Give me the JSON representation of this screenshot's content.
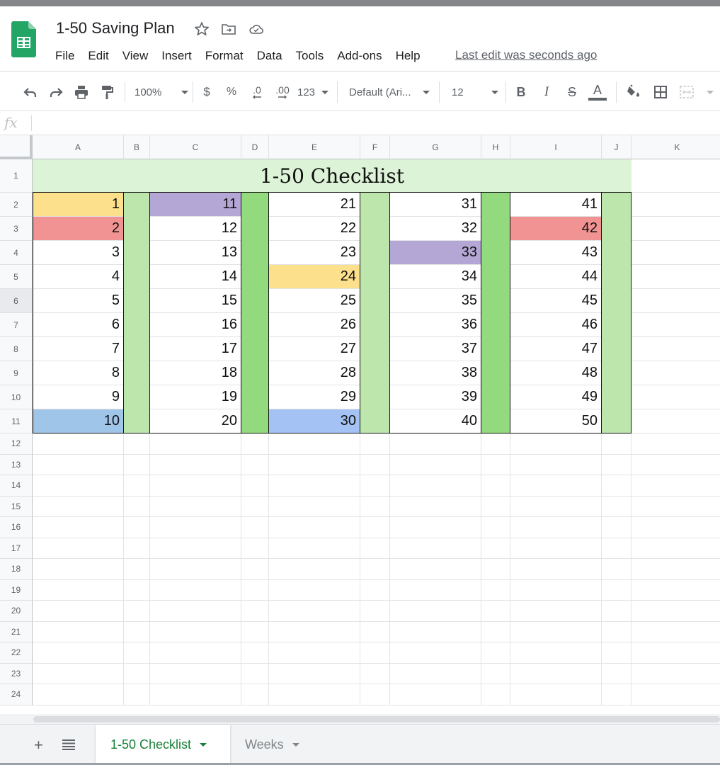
{
  "window": {
    "title": "1-50 Saving Plan",
    "last_edit": "Last edit was seconds ago"
  },
  "menu": [
    "File",
    "Edit",
    "View",
    "Insert",
    "Format",
    "Data",
    "Tools",
    "Add-ons",
    "Help"
  ],
  "toolbar": {
    "zoom": "100%",
    "currency": "$",
    "percent": "%",
    "decrease_decimal": ".0",
    "increase_decimal": ".00",
    "more_formats": "123",
    "font": "Default (Ari...",
    "font_size": "12",
    "bold": "B",
    "italic": "I",
    "strikethrough": "S",
    "text_color_letter": "A"
  },
  "formula_bar": {
    "fx": "fx",
    "value": ""
  },
  "columns": [
    "A",
    "B",
    "C",
    "D",
    "E",
    "F",
    "G",
    "H",
    "I",
    "J",
    "K"
  ],
  "rows": [
    "1",
    "2",
    "3",
    "4",
    "5",
    "6",
    "7",
    "8",
    "9",
    "10",
    "11",
    "12",
    "13",
    "14",
    "15",
    "16",
    "17",
    "18",
    "19",
    "20",
    "21",
    "22",
    "23",
    "24"
  ],
  "sheet": {
    "title": "1-50 Checklist",
    "values": {
      "A": [
        "1",
        "2",
        "3",
        "4",
        "5",
        "6",
        "7",
        "8",
        "9",
        "10"
      ],
      "C": [
        "11",
        "12",
        "13",
        "14",
        "15",
        "16",
        "17",
        "18",
        "19",
        "20"
      ],
      "E": [
        "21",
        "22",
        "23",
        "24",
        "25",
        "26",
        "27",
        "28",
        "29",
        "30"
      ],
      "G": [
        "31",
        "32",
        "33",
        "34",
        "35",
        "36",
        "37",
        "38",
        "39",
        "40"
      ],
      "I": [
        "41",
        "42",
        "43",
        "44",
        "45",
        "46",
        "47",
        "48",
        "49",
        "50"
      ]
    },
    "highlights": [
      {
        "cell": "A2",
        "color": "#fde08b"
      },
      {
        "cell": "A3",
        "color": "#f19393"
      },
      {
        "cell": "A11",
        "color": "#9fc5e8"
      },
      {
        "cell": "C2",
        "color": "#b4a7d6"
      },
      {
        "cell": "E5",
        "color": "#fde08b"
      },
      {
        "cell": "E11",
        "color": "#a4c2f4"
      },
      {
        "cell": "G4",
        "color": "#b4a7d6"
      },
      {
        "cell": "I3",
        "color": "#f19393"
      }
    ],
    "check_columns": [
      {
        "col": "B",
        "color": "#bde6ad"
      },
      {
        "col": "D",
        "color": "#93d97e"
      },
      {
        "col": "F",
        "color": "#bde6ad"
      },
      {
        "col": "H",
        "color": "#93d97e"
      },
      {
        "col": "J",
        "color": "#bde6ad"
      }
    ],
    "title_fill": "#dcf3d7"
  },
  "tabs": [
    {
      "label": "1-50 Checklist",
      "active": true
    },
    {
      "label": "Weeks",
      "active": false
    }
  ],
  "colors": {
    "sheets_green": "#0f9d58",
    "tab_active": "#188038"
  }
}
